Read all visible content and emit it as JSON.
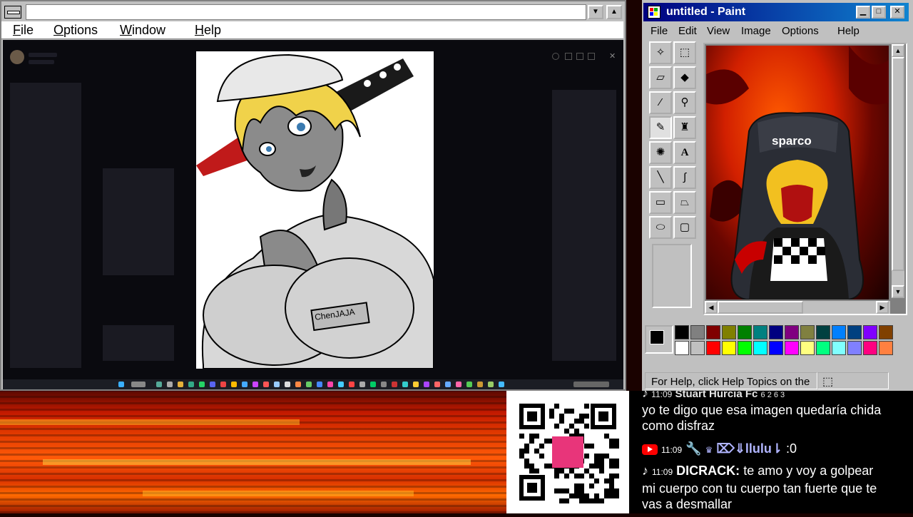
{
  "left_window": {
    "menu": [
      "File",
      "Options",
      "Window",
      "Help"
    ],
    "menu_underline": [
      "F",
      "O",
      "W",
      "H"
    ],
    "name_tag": "ChenJAJA"
  },
  "paint": {
    "title": "untitled - Paint",
    "menu": [
      "File",
      "Edit",
      "View",
      "Image",
      "Options",
      "Help"
    ],
    "status": "For Help, click Help Topics on the",
    "logo_text": "sparco",
    "palette_row1": [
      "#000000",
      "#808080",
      "#800000",
      "#808000",
      "#008000",
      "#008080",
      "#000080",
      "#800080",
      "#808040",
      "#004040",
      "#0080ff",
      "#004080",
      "#8000ff",
      "#804000"
    ],
    "palette_row2": [
      "#ffffff",
      "#c0c0c0",
      "#ff0000",
      "#ffff00",
      "#00ff00",
      "#00ffff",
      "#0000ff",
      "#ff00ff",
      "#ffff80",
      "#00ff80",
      "#80ffff",
      "#8080ff",
      "#ff0080",
      "#ff8040"
    ]
  },
  "chat": {
    "partial_top": "Stuart Hurcia Fc",
    "partial_top_counts": "6  2  6  3",
    "msg1": "yo te digo que esa imagen quedaría chida como disfraz",
    "msg1_line1": "yo te digo que esa imagen quedaría chida",
    "msg1_line2": "como disfraz",
    "msg2_time": "11:09",
    "msg2_name": "⌦⇓llulu⇂",
    "msg2_text": ":0",
    "msg3_time": "11:09",
    "msg3_name": "DICRACK:",
    "msg3_line1": "te amo y voy a golpear",
    "msg3_line2": "mi cuerpo con tu cuerpo tan fuerte que te",
    "msg3_line3": "vas a desmallar"
  }
}
